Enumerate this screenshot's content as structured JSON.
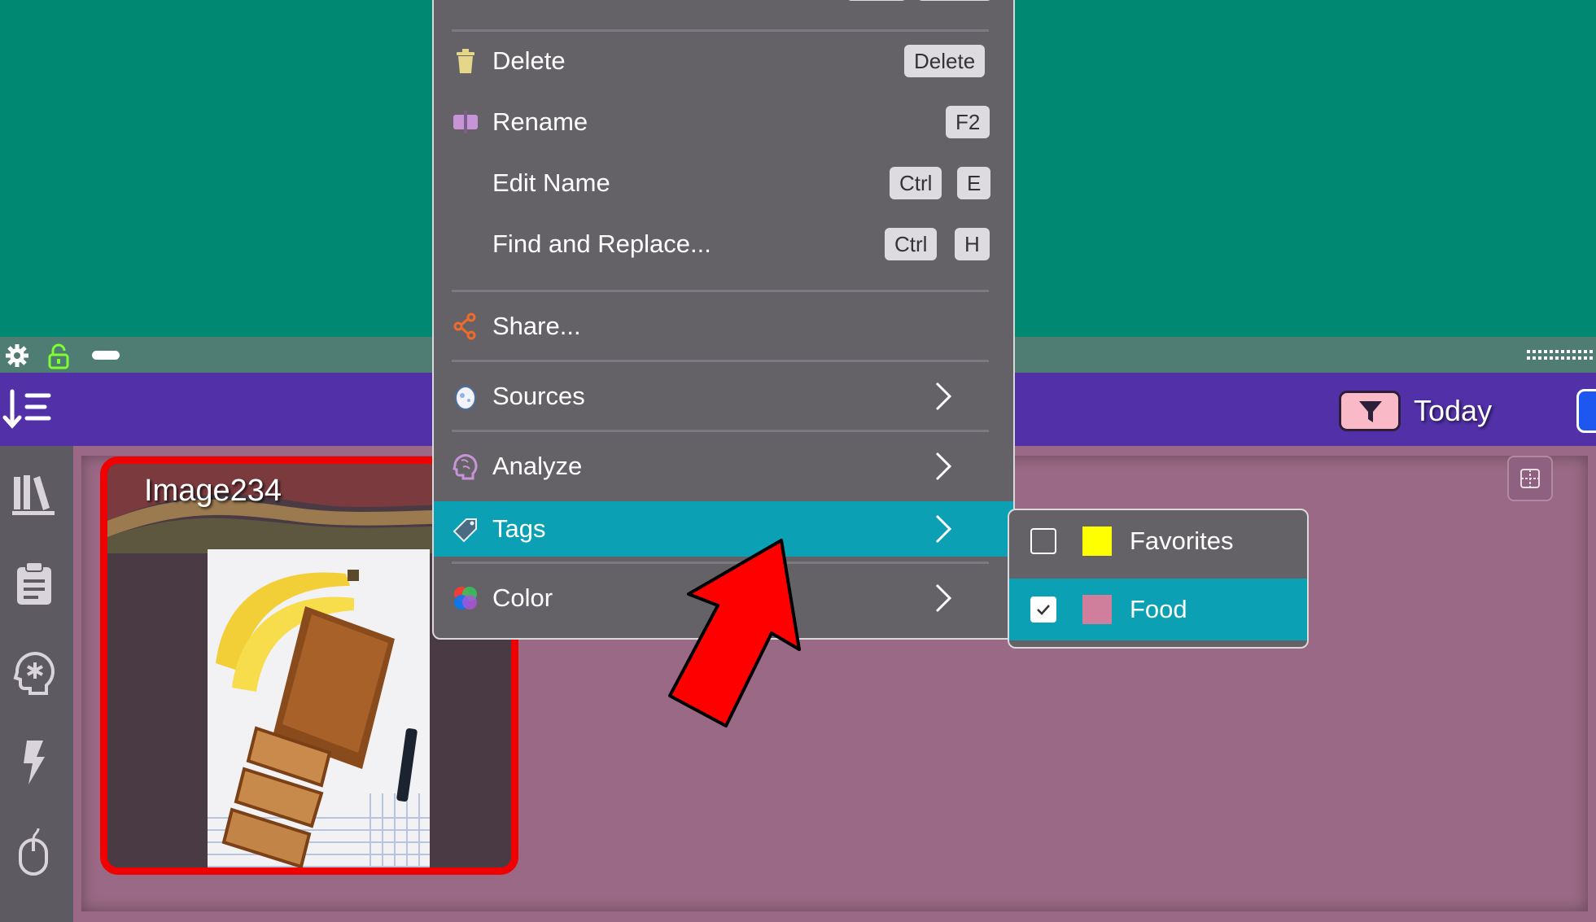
{
  "app": {
    "card": {
      "title": "Image234"
    },
    "header": {
      "filter_label": "Today"
    }
  },
  "context_menu": {
    "items": [
      {
        "id": "delete",
        "label": "Delete",
        "icon": "trash-icon",
        "shortcut": [
          "Delete"
        ]
      },
      {
        "id": "rename",
        "label": "Rename",
        "icon": "rename-icon",
        "shortcut": [
          "F2"
        ]
      },
      {
        "id": "edit-name",
        "label": "Edit Name",
        "shortcut": [
          "Ctrl",
          "E"
        ]
      },
      {
        "id": "find-replace",
        "label": "Find and Replace...",
        "shortcut": [
          "Ctrl",
          "H"
        ]
      },
      {
        "id": "share",
        "label": "Share...",
        "icon": "share-icon"
      },
      {
        "id": "sources",
        "label": "Sources",
        "icon": "egg-icon",
        "submenu": true
      },
      {
        "id": "analyze",
        "label": "Analyze",
        "icon": "brain-icon",
        "submenu": true
      },
      {
        "id": "tags",
        "label": "Tags",
        "icon": "tag-icon",
        "submenu": true,
        "active": true
      },
      {
        "id": "color",
        "label": "Color",
        "icon": "color-wheel-icon",
        "submenu": true
      }
    ]
  },
  "tags_submenu": {
    "items": [
      {
        "label": "Favorites",
        "checked": false,
        "swatch": "#ffff00"
      },
      {
        "label": "Food",
        "checked": true,
        "swatch": "#cf7f9c",
        "active": true
      }
    ]
  },
  "colors": {
    "accent": "#0ca0b4",
    "header": "#5230a7",
    "workspace": "#9a6985",
    "card_border": "#f00000"
  }
}
